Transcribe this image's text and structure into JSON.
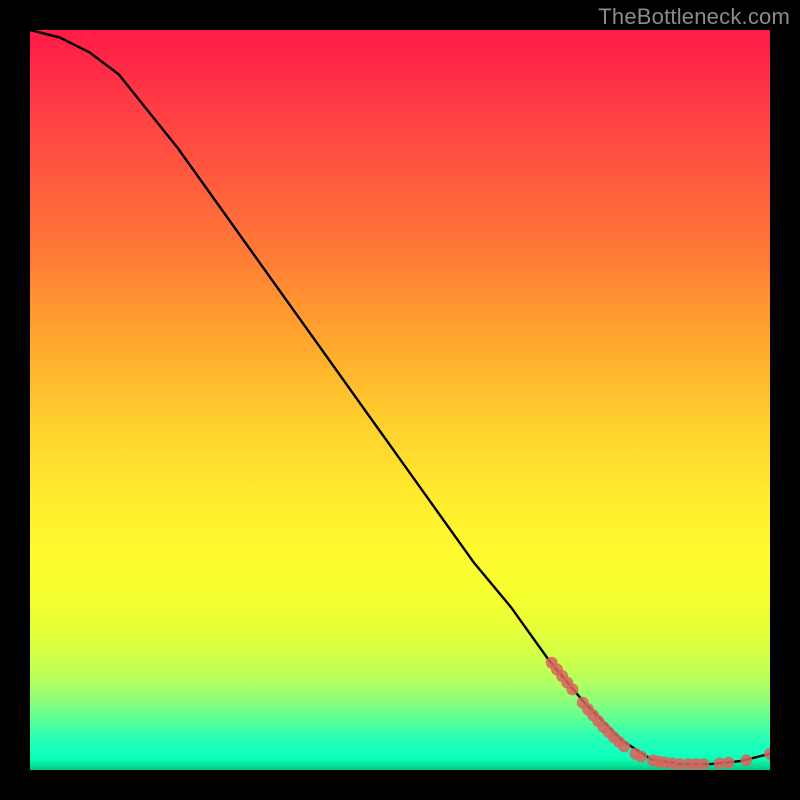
{
  "watermark": "TheBottleneck.com",
  "chart_data": {
    "type": "line",
    "title": "",
    "xlabel": "",
    "ylabel": "",
    "xlim": [
      0,
      100
    ],
    "ylim": [
      0,
      100
    ],
    "legend": false,
    "grid": false,
    "background": "vertical-rainbow-gradient",
    "curve": {
      "name": "bottleneck-curve",
      "color": "#000000",
      "points": [
        {
          "x": 0,
          "y": 100
        },
        {
          "x": 4,
          "y": 99
        },
        {
          "x": 8,
          "y": 97
        },
        {
          "x": 12,
          "y": 94
        },
        {
          "x": 16,
          "y": 89
        },
        {
          "x": 20,
          "y": 84
        },
        {
          "x": 25,
          "y": 77
        },
        {
          "x": 30,
          "y": 70
        },
        {
          "x": 35,
          "y": 63
        },
        {
          "x": 40,
          "y": 56
        },
        {
          "x": 45,
          "y": 49
        },
        {
          "x": 50,
          "y": 42
        },
        {
          "x": 55,
          "y": 35
        },
        {
          "x": 60,
          "y": 28
        },
        {
          "x": 65,
          "y": 22
        },
        {
          "x": 70,
          "y": 15
        },
        {
          "x": 75,
          "y": 9
        },
        {
          "x": 80,
          "y": 4
        },
        {
          "x": 84,
          "y": 1.4
        },
        {
          "x": 88,
          "y": 0.8
        },
        {
          "x": 92,
          "y": 0.8
        },
        {
          "x": 96,
          "y": 1.2
        },
        {
          "x": 100,
          "y": 2.2
        }
      ]
    },
    "markers": {
      "name": "highlight-points",
      "color": "#d9645e",
      "radius_px": 6,
      "points": [
        {
          "x": 70.5,
          "y": 14.5
        },
        {
          "x": 71.2,
          "y": 13.6
        },
        {
          "x": 71.9,
          "y": 12.7
        },
        {
          "x": 72.6,
          "y": 11.8
        },
        {
          "x": 73.3,
          "y": 10.9
        },
        {
          "x": 74.7,
          "y": 9.1
        },
        {
          "x": 75.4,
          "y": 8.2
        },
        {
          "x": 76.1,
          "y": 7.4
        },
        {
          "x": 76.8,
          "y": 6.6
        },
        {
          "x": 77.5,
          "y": 5.8
        },
        {
          "x": 78.2,
          "y": 5.1
        },
        {
          "x": 78.9,
          "y": 4.4
        },
        {
          "x": 79.6,
          "y": 3.8
        },
        {
          "x": 80.3,
          "y": 3.2
        },
        {
          "x": 81.8,
          "y": 2.2
        },
        {
          "x": 82.6,
          "y": 1.8
        },
        {
          "x": 84.2,
          "y": 1.3
        },
        {
          "x": 85.0,
          "y": 1.1
        },
        {
          "x": 85.8,
          "y": 1.0
        },
        {
          "x": 86.8,
          "y": 0.9
        },
        {
          "x": 87.8,
          "y": 0.8
        },
        {
          "x": 89.0,
          "y": 0.8
        },
        {
          "x": 90.0,
          "y": 0.8
        },
        {
          "x": 91.0,
          "y": 0.8
        },
        {
          "x": 93.2,
          "y": 0.9
        },
        {
          "x": 94.4,
          "y": 1.0
        },
        {
          "x": 96.8,
          "y": 1.3
        },
        {
          "x": 100.0,
          "y": 2.2
        }
      ]
    }
  }
}
